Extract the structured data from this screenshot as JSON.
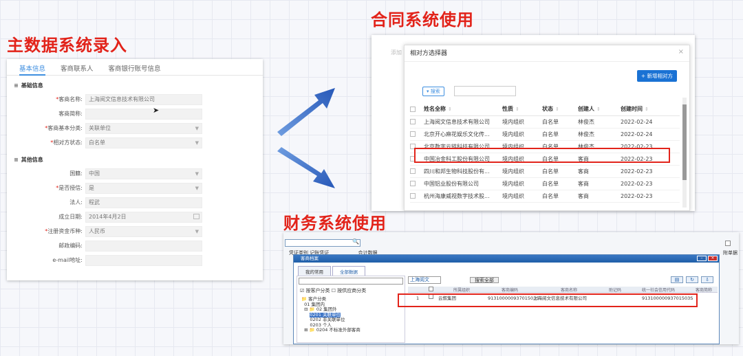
{
  "headings": {
    "master": "主数据系统录入",
    "contract": "合同系统使用",
    "finance": "财务系统使用"
  },
  "master_panel": {
    "tabs": [
      "基本信息",
      "客商联系人",
      "客商银行账号信息"
    ],
    "section_basic": "基础信息",
    "section_other": "其他信息",
    "fields": [
      {
        "label": "客商名称:",
        "required": "*",
        "value": "上海阅文信息技术有限公司"
      },
      {
        "label": "客商简称:",
        "required": "",
        "value": ""
      },
      {
        "label": "客商基本分类:",
        "required": "*",
        "value": "关联单位"
      },
      {
        "label": "相对方状态:",
        "required": "*",
        "value": "白名单"
      },
      {
        "label": "国籍:",
        "required": "",
        "value": "中国"
      },
      {
        "label": "是否授信:",
        "required": "*",
        "value": "是"
      },
      {
        "label": "法人:",
        "required": "",
        "value": "程武"
      },
      {
        "label": "成立日期:",
        "required": "",
        "value": "2014年4月2日"
      },
      {
        "label": "注册资金币种:",
        "required": "*",
        "value": "人民币"
      },
      {
        "label": "邮政编码:",
        "required": "",
        "value": ""
      },
      {
        "label": "e-mail地址:",
        "required": "",
        "value": ""
      }
    ]
  },
  "contract_panel": {
    "ghost_text": "添加",
    "dialog_title": "相对方选择器",
    "close_icon": "×",
    "add_button": "+ 新增相对方",
    "search_button": "▾ 搜索",
    "columns": [
      "姓名全称",
      "性质",
      "状态",
      "创建人",
      "创建时间"
    ],
    "rows": [
      [
        "上海阅文信息技术有限公司",
        "境内组织",
        "白名单",
        "林俊杰",
        "2022-02-24"
      ],
      [
        "北京开心麻花娱乐文化传...",
        "境内组织",
        "白名单",
        "林俊杰",
        "2022-02-24"
      ],
      [
        "北京数字云链科技有限公司",
        "境内组织",
        "白名单",
        "林俊杰",
        "2022-02-23"
      ],
      [
        "中国冶金科工股份有限公司",
        "境内组织",
        "白名单",
        "客商",
        "2022-02-23"
      ],
      [
        "四川和邦生物科技股份有...",
        "境内组织",
        "白名单",
        "客商",
        "2022-02-23"
      ],
      [
        "中国铝业股份有限公司",
        "境内组织",
        "白名单",
        "客商",
        "2022-02-23"
      ],
      [
        "杭州海康威视数字技术股...",
        "境内组织",
        "白名单",
        "客商",
        "2022-02-23"
      ]
    ],
    "highlight_color": "#e2231a"
  },
  "finance_panel": {
    "bg_row_text": "凭证类别  记账凭证",
    "bg_row_text2": "合计数据",
    "window_title": "客商档案",
    "left_tabs": [
      "我的常用",
      "全部数据"
    ],
    "left_options": "☑ 按客户分类  ☐ 按供应商分类",
    "tree": [
      "客户分类",
      "01 集团内",
      "02 集团外",
      "0201 关联单位",
      "0202 非关联单位",
      "0203 个人",
      "0204 不标准外部客商"
    ],
    "search_value": "上海阅文",
    "search_all_button": "搜索全部",
    "grid_columns": [
      "所属组织",
      "客商编码",
      "客商名称",
      "助记码",
      "统一社会信用代码",
      "客商简称"
    ],
    "grid_row": {
      "index": "1",
      "org": "云叙集团",
      "code": "91310000093701503S",
      "name": "上海阅文信息技术有限公司",
      "credit_code": "91310000093701503S"
    },
    "side_label": "附单据"
  }
}
